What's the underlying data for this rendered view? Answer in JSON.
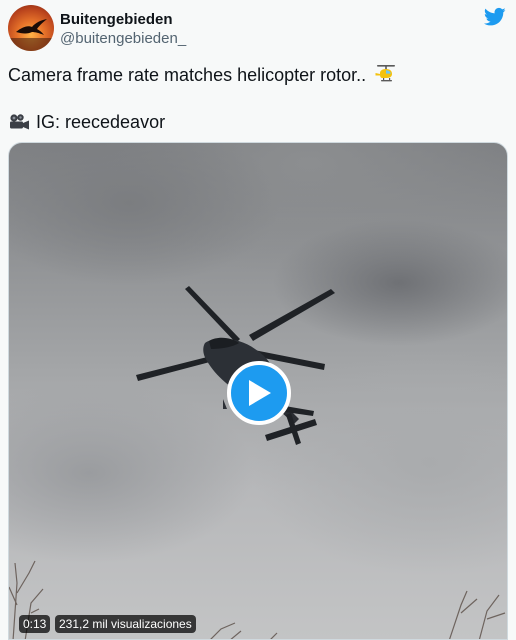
{
  "author": {
    "display_name": "Buitengebieden",
    "handle": "@buitengebieden_"
  },
  "tweet": {
    "text": "Camera frame rate matches helicopter rotor..",
    "emoji_icon": "helicopter-emoji",
    "credit_icon": "movie-camera-emoji",
    "credit_text": "IG: reecedeavor"
  },
  "video": {
    "elapsed": "0:13",
    "views": "231,2 mil visualizaciones"
  },
  "icons": {
    "brand": "twitter-bird-icon",
    "play": "play-icon"
  },
  "colors": {
    "brand_blue": "#1d9bf0",
    "text_primary": "#0f1419",
    "text_secondary": "#536471",
    "background": "#f7f9f9"
  }
}
